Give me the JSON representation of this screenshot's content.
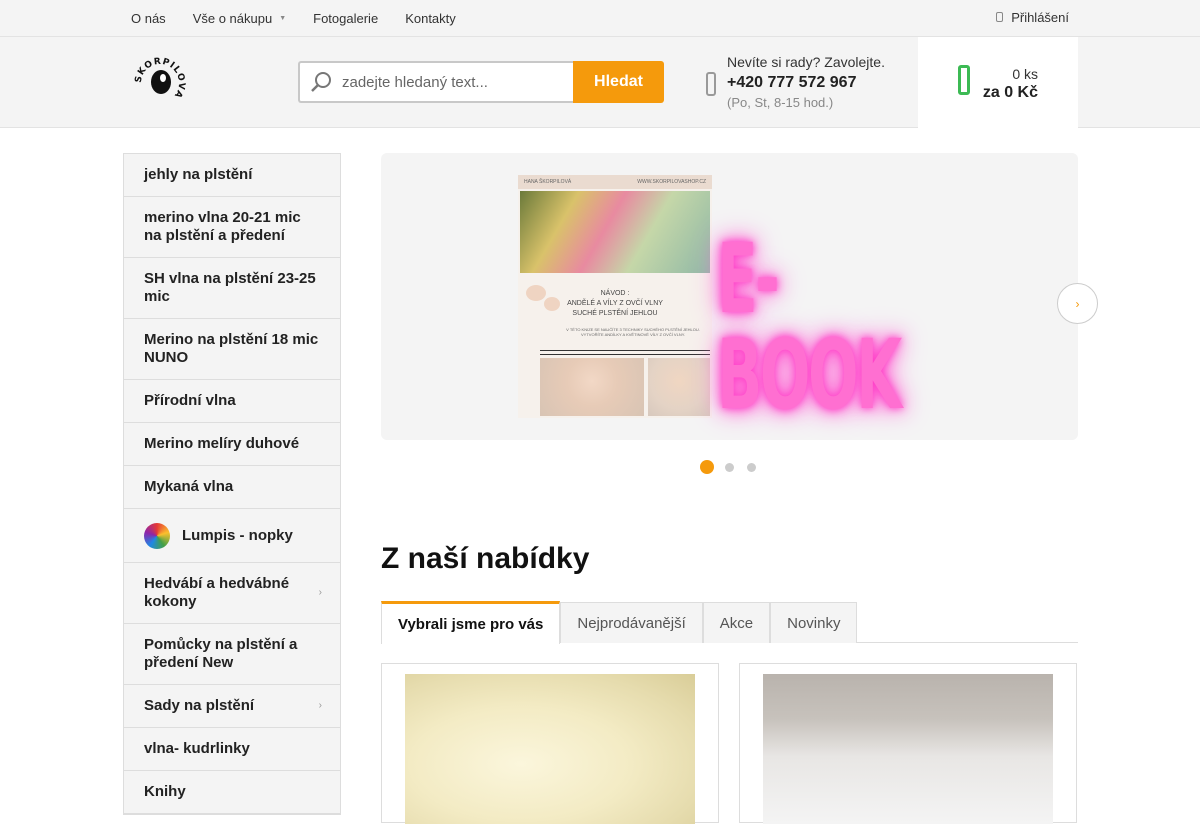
{
  "topnav": {
    "items": [
      "O nás",
      "Vše o nákupu",
      "Fotogalerie",
      "Kontakty"
    ],
    "login": "Přihlášení"
  },
  "header": {
    "logo_text": "SKORPILOVA",
    "search_placeholder": "zadejte hledaný text...",
    "search_button": "Hledat",
    "contact_question": "Nevíte si rady? Zavolejte.",
    "phone": "+420 777 572 967",
    "hours": "(Po, St, 8-15 hod.)",
    "cart_count": "0 ks",
    "cart_price": "za 0 Kč"
  },
  "sidebar": {
    "items": [
      "jehly na plstění",
      "merino vlna 20-21 mic na plstění a předení",
      "SH vlna na plstění 23-25 mic",
      "Merino na plstění 18 mic NUNO",
      "Přírodní vlna",
      "Merino melíry duhové",
      "Mykaná vlna",
      "Lumpis - nopky",
      "Hedvábí a hedvábné kokony",
      "Pomůcky na plstění a předení New",
      "Sady na plstění",
      "vlna- kudrlinky",
      "Knihy"
    ]
  },
  "banner": {
    "headline": "E-BOOK",
    "doc_header_left": "HANA ŠKORPILOVÁ",
    "doc_header_right": "WWW.SKORPILOVASHOP.CZ",
    "doc_title_1": "NÁVOD :",
    "doc_title_2": "ANDĚLÉ A VÍLY Z OVČÍ VLNY",
    "doc_title_3": "SUCHÉ PLSTĚNÍ JEHLOU",
    "doc_sub": "V TÉTO KNIZE SE NAUČÍTE 3 TECHNIKY SUCHÉHO PLSTĚNÍ JEHLOU. VYTVOŘÍTE ANDÍLKY A KVĚTINOVÉ VÍLY Z OVČÍ VLNY.",
    "slides": 3,
    "active_slide": 1
  },
  "offers": {
    "title": "Z naší nabídky",
    "tabs": [
      "Vybrali jsme pro vás",
      "Nejprodávanější",
      "Akce",
      "Novinky"
    ]
  },
  "colors": {
    "accent": "#f59a0c",
    "cart_green": "#3cba54",
    "glow_pink": "#ff6fd1"
  }
}
